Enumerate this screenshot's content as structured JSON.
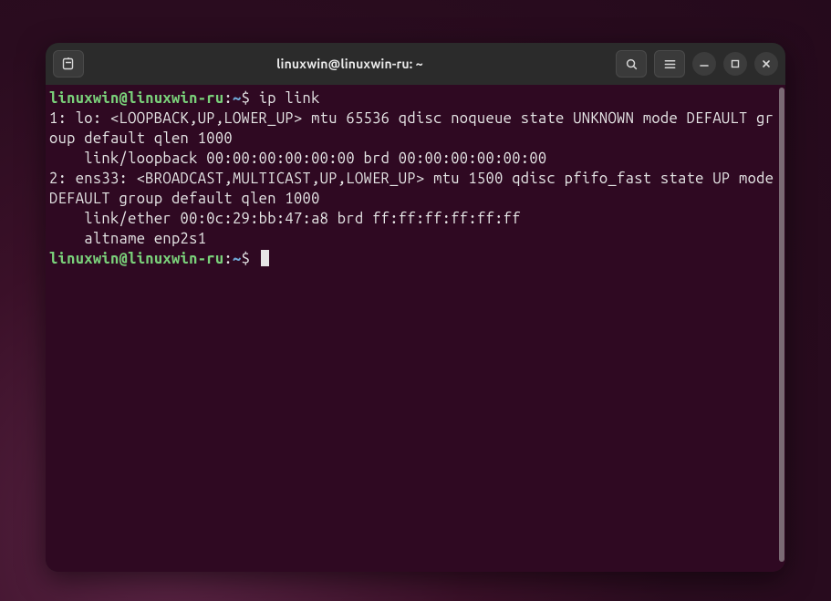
{
  "window": {
    "title": "linuxwin@linuxwin-ru: ~"
  },
  "prompt": {
    "user_host": "linuxwin@linuxwin-ru",
    "separator": ":",
    "path": "~",
    "symbol": "$"
  },
  "session": {
    "command1": " ip link",
    "output_lines": [
      "1: lo: <LOOPBACK,UP,LOWER_UP> mtu 65536 qdisc noqueue state UNKNOWN mode DEFAULT group default qlen 1000",
      "    link/loopback 00:00:00:00:00:00 brd 00:00:00:00:00:00",
      "2: ens33: <BROADCAST,MULTICAST,UP,LOWER_UP> mtu 1500 qdisc pfifo_fast state UP mode DEFAULT group default qlen 1000",
      "    link/ether 00:0c:29:bb:47:a8 brd ff:ff:ff:ff:ff:ff",
      "    altname enp2s1"
    ]
  },
  "colors": {
    "terminal_bg": "#2f0922",
    "prompt_user": "#7ad17a",
    "prompt_path": "#6fa8d6",
    "text": "#e6e6e6",
    "titlebar_bg": "#2b2b2b"
  }
}
